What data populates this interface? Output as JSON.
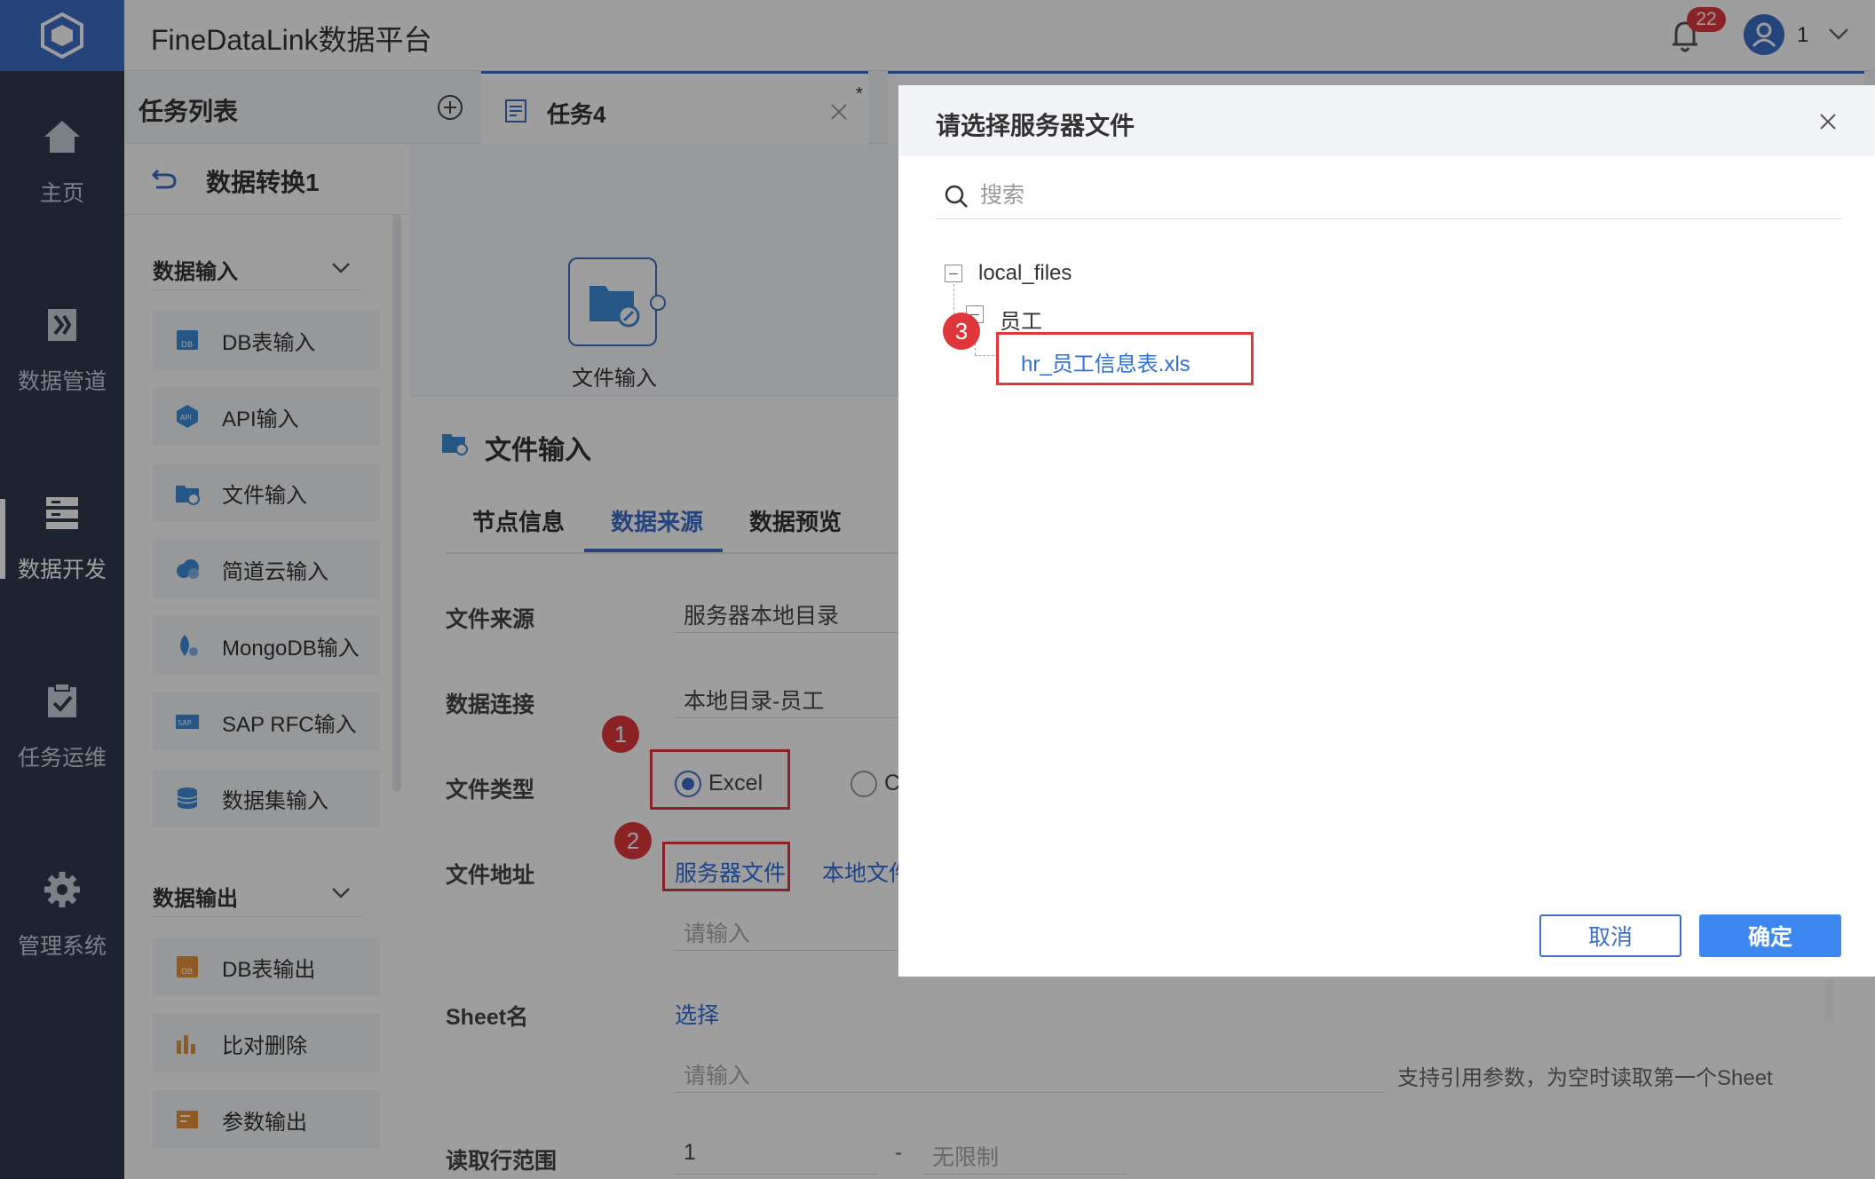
{
  "header": {
    "app_title": "FineDataLink数据平台",
    "notifications": "22",
    "user": "1"
  },
  "nav": [
    {
      "label": "主页",
      "icon": "home-icon"
    },
    {
      "label": "数据管道",
      "icon": "pipeline-icon"
    },
    {
      "label": "数据开发",
      "icon": "dev-icon"
    },
    {
      "label": "任务运维",
      "icon": "task-ops-icon"
    },
    {
      "label": "管理系统",
      "icon": "gear-icon"
    }
  ],
  "task_panel": {
    "title": "任务列表",
    "flow_name": "数据转换1",
    "input_group": "数据输入",
    "inputs": [
      "DB表输入",
      "API输入",
      "文件输入",
      "简道云输入",
      "MongoDB输入",
      "SAP RFC输入",
      "数据集输入"
    ],
    "output_group": "数据输出",
    "outputs": [
      "DB表输出",
      "比对删除",
      "参数输出"
    ]
  },
  "tabs": {
    "active": "任务4",
    "star": "*"
  },
  "canvas": {
    "node_label": "文件输入"
  },
  "props": {
    "title": "文件输入",
    "subtabs": [
      "节点信息",
      "数据来源",
      "数据预览"
    ],
    "active_subtab": "数据来源",
    "file_source_label": "文件来源",
    "file_source_value": "服务器本地目录",
    "connection_label": "数据连接",
    "connection_value": "本地目录-员工",
    "file_type_label": "文件类型",
    "file_type_excel": "Excel",
    "file_type_other": "C",
    "file_addr_label": "文件地址",
    "server_file": "服务器文件",
    "local_file": "本地文件",
    "addr_placeholder": "请输入",
    "sheet_label": "Sheet名",
    "sheet_select": "选择",
    "sheet_placeholder": "请输入",
    "sheet_hint": "支持引用参数，为空时读取第一个Sheet",
    "range_label": "读取行范围",
    "range_start": "1",
    "range_sep": "-",
    "range_end_placeholder": "无限制"
  },
  "steps": [
    "1",
    "2",
    "3"
  ],
  "dialog": {
    "title": "请选择服务器文件",
    "search_placeholder": "搜索",
    "tree_root": "local_files",
    "tree_folder": "员工",
    "tree_file": "hr_员工信息表.xls",
    "cancel": "取消",
    "ok": "确定"
  },
  "colors": {
    "accent": "#3d6fc9",
    "highlight": "#e0373d",
    "primary_button": "#3d87f0"
  }
}
